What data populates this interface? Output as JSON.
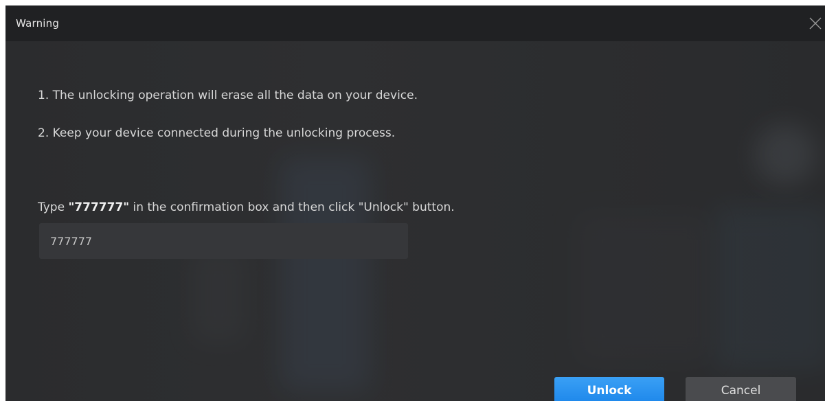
{
  "window": {
    "title": "Warning",
    "close_icon": "close-icon"
  },
  "message": {
    "line1": "1. The unlocking operation will erase all the data on your device.",
    "line2": "2. Keep your device connected during the unlocking process.",
    "instruction_prefix": "Type ",
    "instruction_code": "\"777777\"",
    "instruction_suffix": " in the confirmation box and then click \"Unlock\" button."
  },
  "confirmation": {
    "value": "777777"
  },
  "buttons": {
    "unlock_label": "Unlock",
    "cancel_label": "Cancel"
  },
  "colors": {
    "accent": "#1c86ea",
    "background": "#2a2b2d",
    "titlebar": "#202123"
  }
}
